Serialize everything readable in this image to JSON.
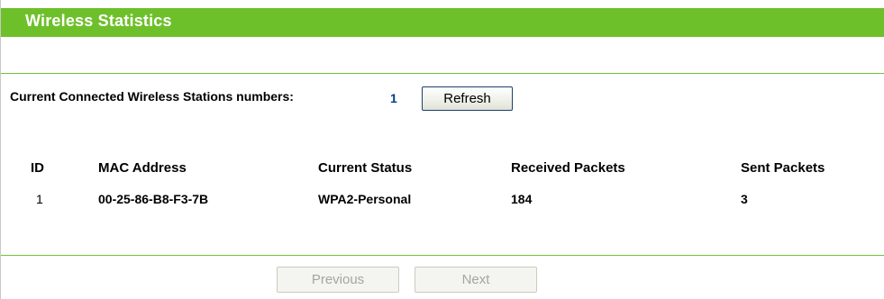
{
  "header": {
    "title": "Wireless Statistics"
  },
  "summary": {
    "label": "Current Connected Wireless Stations numbers:",
    "count": "1",
    "refresh_label": "Refresh"
  },
  "table": {
    "columns": [
      "ID",
      "MAC Address",
      "Current Status",
      "Received Packets",
      "Sent Packets"
    ],
    "rows": [
      {
        "id": "1",
        "mac": "00-25-86-B8-F3-7B",
        "status": "WPA2-Personal",
        "received": "184",
        "sent": "3"
      }
    ]
  },
  "pagination": {
    "previous_label": "Previous",
    "next_label": "Next"
  },
  "colors": {
    "title_bar": "#6ec02b",
    "divider": "#71bf3a",
    "count_text": "#003c8a"
  }
}
